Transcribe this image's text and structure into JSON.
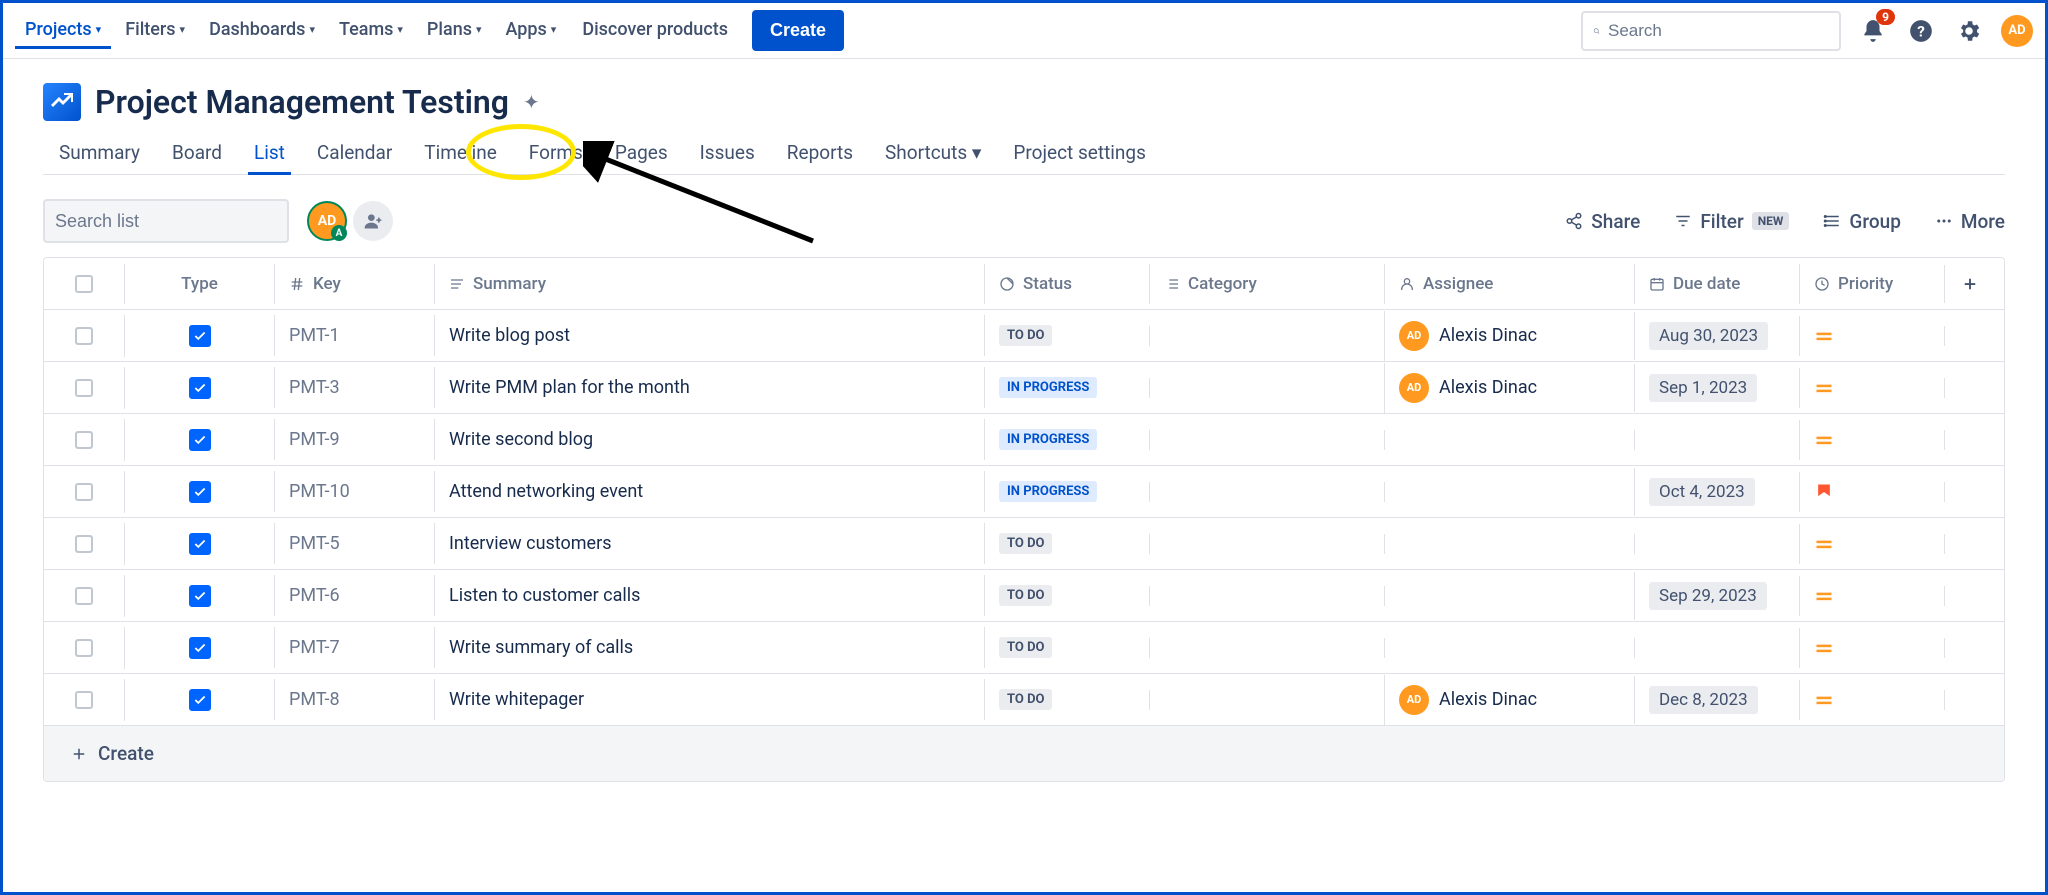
{
  "topnav": {
    "items": [
      {
        "label": "Projects",
        "dropdown": true,
        "active": true
      },
      {
        "label": "Filters",
        "dropdown": true
      },
      {
        "label": "Dashboards",
        "dropdown": true
      },
      {
        "label": "Teams",
        "dropdown": true
      },
      {
        "label": "Plans",
        "dropdown": true
      },
      {
        "label": "Apps",
        "dropdown": true
      },
      {
        "label": "Discover products",
        "dropdown": false
      }
    ],
    "create": "Create",
    "search_placeholder": "Search",
    "notif_count": "9",
    "avatar": "AD"
  },
  "project": {
    "title": "Project Management Testing",
    "tabs": [
      "Summary",
      "Board",
      "List",
      "Calendar",
      "Timeline",
      "Forms",
      "Pages",
      "Issues",
      "Reports",
      "Shortcuts",
      "Project settings"
    ],
    "active_tab": "List"
  },
  "toolbar": {
    "search_placeholder": "Search list",
    "avatar": "AD",
    "actions": {
      "share": "Share",
      "filter": "Filter",
      "filter_badge": "NEW",
      "group": "Group",
      "more": "More"
    }
  },
  "table": {
    "columns": {
      "type": "Type",
      "key": "Key",
      "summary": "Summary",
      "status": "Status",
      "category": "Category",
      "assignee": "Assignee",
      "due": "Due date",
      "priority": "Priority"
    },
    "rows": [
      {
        "key": "PMT-1",
        "summary": "Write blog post",
        "status": "TO DO",
        "status_class": "todo",
        "assignee": "Alexis Dinac",
        "assignee_av": "AD",
        "due": "Aug 30, 2023",
        "priority": "medium"
      },
      {
        "key": "PMT-3",
        "summary": "Write PMM plan for the month",
        "status": "IN PROGRESS",
        "status_class": "prog",
        "assignee": "Alexis Dinac",
        "assignee_av": "AD",
        "due": "Sep 1, 2023",
        "priority": "medium"
      },
      {
        "key": "PMT-9",
        "summary": "Write second blog",
        "status": "IN PROGRESS",
        "status_class": "prog",
        "assignee": "",
        "assignee_av": "",
        "due": "",
        "priority": "medium"
      },
      {
        "key": "PMT-10",
        "summary": "Attend networking event",
        "status": "IN PROGRESS",
        "status_class": "prog",
        "assignee": "",
        "assignee_av": "",
        "due": "Oct 4, 2023",
        "priority": "high"
      },
      {
        "key": "PMT-5",
        "summary": "Interview customers",
        "status": "TO DO",
        "status_class": "todo",
        "assignee": "",
        "assignee_av": "",
        "due": "",
        "priority": "medium"
      },
      {
        "key": "PMT-6",
        "summary": "Listen to customer calls",
        "status": "TO DO",
        "status_class": "todo",
        "assignee": "",
        "assignee_av": "",
        "due": "Sep 29, 2023",
        "priority": "medium"
      },
      {
        "key": "PMT-7",
        "summary": "Write summary of calls",
        "status": "TO DO",
        "status_class": "todo",
        "assignee": "",
        "assignee_av": "",
        "due": "",
        "priority": "medium"
      },
      {
        "key": "PMT-8",
        "summary": "Write whitepager",
        "status": "TO DO",
        "status_class": "todo",
        "assignee": "Alexis Dinac",
        "assignee_av": "AD",
        "due": "Dec 8, 2023",
        "priority": "medium"
      }
    ],
    "create_label": "Create"
  }
}
